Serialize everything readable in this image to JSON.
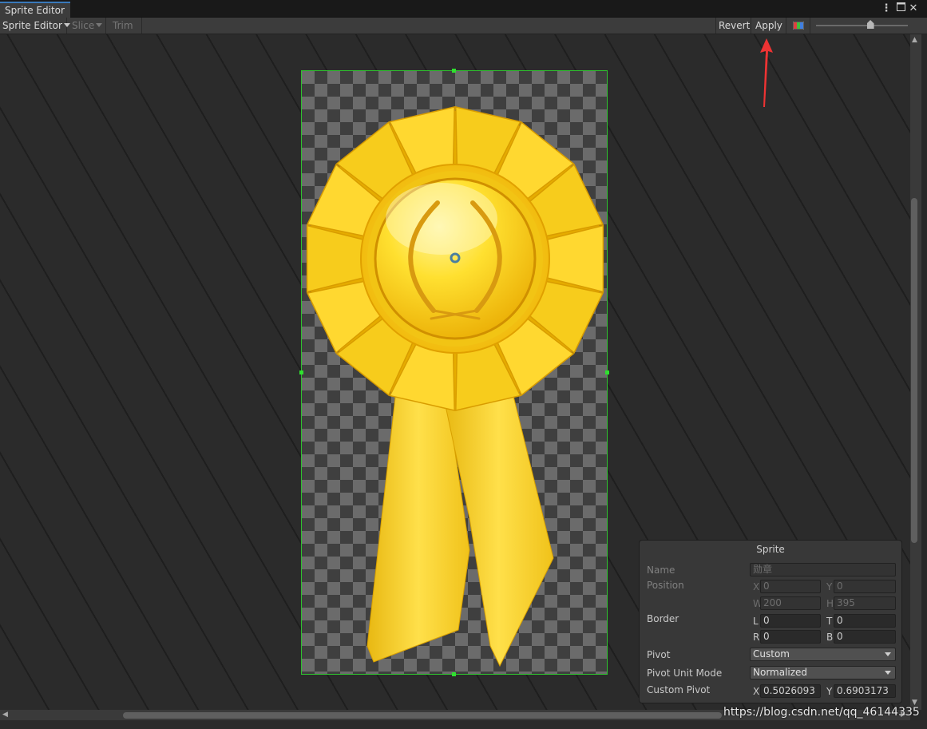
{
  "window": {
    "tab_title": "Sprite Editor"
  },
  "toolbar": {
    "mode_label": "Sprite Editor",
    "slice_label": "Slice",
    "trim_label": "Trim",
    "revert_label": "Revert",
    "apply_label": "Apply",
    "zoom_level": 0.6
  },
  "sprite_panel": {
    "title": "Sprite",
    "name_label": "Name",
    "name_value": "勋章",
    "position_label": "Position",
    "pos_x_axis": "X",
    "pos_x": "0",
    "pos_y_axis": "Y",
    "pos_y": "0",
    "pos_w_axis": "W",
    "pos_w": "200",
    "pos_h_axis": "H",
    "pos_h": "395",
    "border_label": "Border",
    "border_l_axis": "L",
    "border_l": "0",
    "border_t_axis": "T",
    "border_t": "0",
    "border_r_axis": "R",
    "border_r": "0",
    "border_b_axis": "B",
    "border_b": "0",
    "pivot_label": "Pivot",
    "pivot_value": "Custom",
    "pivot_unit_label": "Pivot Unit Mode",
    "pivot_unit_value": "Normalized",
    "custom_pivot_label": "Custom Pivot",
    "cp_x_axis": "X",
    "cp_x": "0.5026093",
    "cp_y_axis": "Y",
    "cp_y": "0.6903173"
  },
  "watermark": "https://blog.csdn.net/qq_46144335",
  "colors": {
    "accent": "#3a79bb",
    "selection": "#2fc22f",
    "medal": "#f5c518",
    "annotation_arrow": "#ee3333"
  },
  "icons": [
    "menu-icon",
    "maximize-icon",
    "close-icon",
    "color-channel-icon",
    "zoom-slider-icon",
    "pivot-icon"
  ]
}
